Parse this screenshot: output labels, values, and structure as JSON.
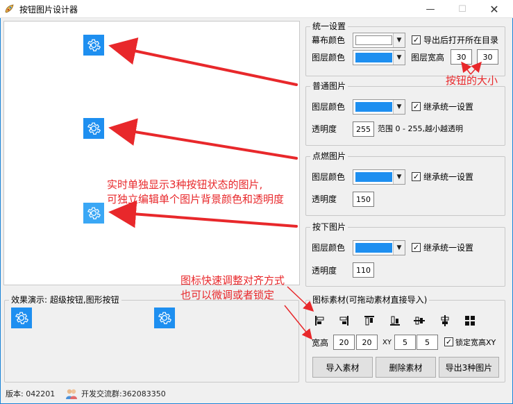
{
  "window": {
    "title": "按钮图片设计器",
    "min_glyph": "—",
    "max_glyph": "☐",
    "close_glyph": "✕"
  },
  "unified": {
    "legend": "统一设置",
    "canvas_color_label": "幕布颜色",
    "canvas_color": "#ffffff",
    "open_dir_label": "导出后打开所在目录",
    "layer_color_label": "图层颜色",
    "layer_color": "#1e8ff0",
    "size_label": "图层宽高",
    "width": "30",
    "height": "30"
  },
  "normal": {
    "legend": "普通图片",
    "layer_color_label": "图层颜色",
    "layer_color": "#1e8ff0",
    "inherit_label": "继承统一设置",
    "opacity_label": "透明度",
    "opacity": "255",
    "range_hint": "范围 0 - 255,越小越透明"
  },
  "hover": {
    "legend": "点燃图片",
    "layer_color_label": "图层颜色",
    "layer_color": "#1e8ff0",
    "inherit_label": "继承统一设置",
    "opacity_label": "透明度",
    "opacity": "150"
  },
  "pressed": {
    "legend": "按下图片",
    "layer_color_label": "图层颜色",
    "layer_color": "#1e8ff0",
    "inherit_label": "继承统一设置",
    "opacity_label": "透明度",
    "opacity": "110"
  },
  "materials": {
    "legend": "图标素材(可拖动素材直接导入)",
    "size_label": "宽高",
    "w": "20",
    "h": "20",
    "xy_label": "XY",
    "x": "5",
    "y": "5",
    "lock_label": "锁定宽高XY",
    "import_btn": "导入素材",
    "delete_btn": "删除素材",
    "export_btn": "导出3种图片"
  },
  "demo": {
    "legend": "效果演示: 超级按钮,图形按钮"
  },
  "status": {
    "version": "版本: 042201",
    "group": "开发交流群:362083350"
  },
  "annotations": {
    "size_note": "按钮的大小",
    "realtime_line1": "实时单独显示3种按钮状态的图片,",
    "realtime_line2": "可独立编辑单个图片背景颜色和透明度",
    "align_line1": "图标快速调整对齐方式",
    "align_line2": "也可以微调或者锁定"
  },
  "colors": {
    "accent": "#1e8ff0",
    "annotation": "#e8282b"
  }
}
